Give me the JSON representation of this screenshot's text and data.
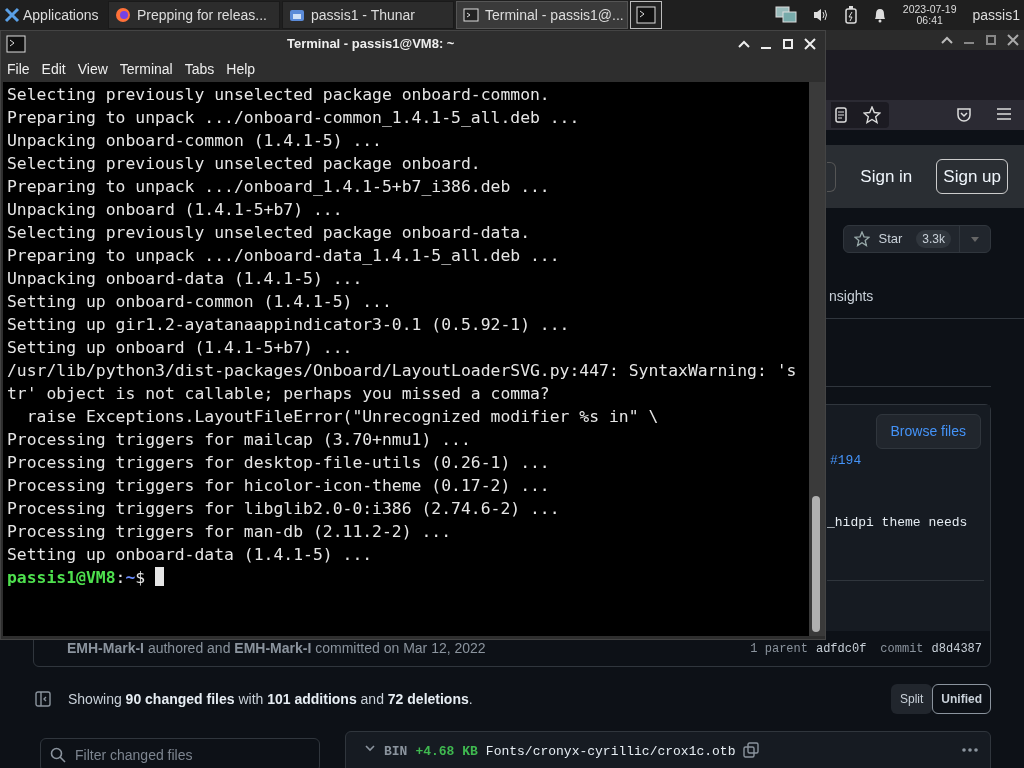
{
  "taskbar": {
    "applications_label": "Applications",
    "tasks": [
      {
        "label": "Prepping for releas...",
        "kind": "browser",
        "selected": false
      },
      {
        "label": "passis1 - Thunar",
        "kind": "folder",
        "selected": false
      },
      {
        "label": "Terminal - passis1@...",
        "kind": "terminal",
        "selected": true
      }
    ],
    "clock": {
      "date": "2023-07-19",
      "time": "06:41"
    },
    "user": "passis1"
  },
  "browser": {
    "header": {
      "sign_in": "Sign in",
      "sign_up": "Sign up"
    },
    "repo": {
      "star_label": "Star",
      "star_count": "3.3k",
      "tab_partial": "nsights"
    },
    "commit": {
      "browse_files": "Browse files",
      "pr_link": "#194",
      "message_partial": "_hidpi theme needs",
      "byline": "**EMH-Mark-I** authored and **EMH-Mark-I** committed on Mar 12, 2022",
      "parent_label": "1 parent",
      "parent_sha": "adfdc0f",
      "commit_label": "commit",
      "commit_sha": "d8d4387"
    },
    "summary": "Showing **90 changed files** with **101 additions** and **72 deletions**.",
    "view_modes": [
      {
        "label": "Split",
        "selected": false
      },
      {
        "label": "Unified",
        "selected": true
      }
    ],
    "filter": {
      "placeholder": "Filter changed files"
    },
    "file": {
      "type": "BIN",
      "size": "+4.68 KB",
      "path": "Fonts/cronyx-cyrillic/crox1c.otb"
    }
  },
  "terminal": {
    "title": "Terminal - passis1@VM8: ~",
    "menu": [
      "File",
      "Edit",
      "View",
      "Terminal",
      "Tabs",
      "Help"
    ],
    "lines": [
      "Selecting previously unselected package onboard-common.",
      "Preparing to unpack .../onboard-common_1.4.1-5_all.deb ...",
      "Unpacking onboard-common (1.4.1-5) ...",
      "Selecting previously unselected package onboard.",
      "Preparing to unpack .../onboard_1.4.1-5+b7_i386.deb ...",
      "Unpacking onboard (1.4.1-5+b7) ...",
      "Selecting previously unselected package onboard-data.",
      "Preparing to unpack .../onboard-data_1.4.1-5_all.deb ...",
      "Unpacking onboard-data (1.4.1-5) ...",
      "Setting up onboard-common (1.4.1-5) ...",
      "Setting up gir1.2-ayatanaappindicator3-0.1 (0.5.92-1) ...",
      "Setting up onboard (1.4.1-5+b7) ...",
      "/usr/lib/python3/dist-packages/Onboard/LayoutLoaderSVG.py:447: SyntaxWarning: 's",
      "tr' object is not callable; perhaps you missed a comma?",
      "  raise Exceptions.LayoutFileError(\"Unrecognized modifier %s in\" \\",
      "Processing triggers for mailcap (3.70+nmu1) ...",
      "Processing triggers for desktop-file-utils (0.26-1) ...",
      "Processing triggers for hicolor-icon-theme (0.17-2) ...",
      "Processing triggers for libglib2.0-0:i386 (2.74.6-2) ...",
      "Processing triggers for man-db (2.11.2-2) ...",
      "Setting up onboard-data (1.4.1-5) ..."
    ],
    "prompt": {
      "user_host": "passis1@VM8",
      "separator": ":",
      "path": "~",
      "symbol": "$"
    }
  }
}
